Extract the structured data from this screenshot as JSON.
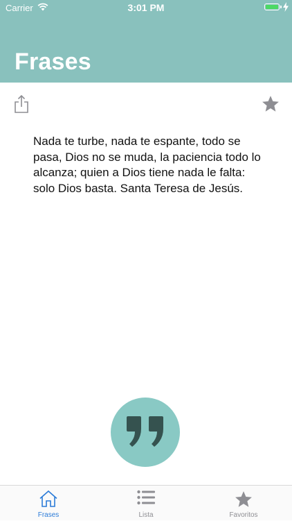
{
  "status_bar": {
    "carrier": "Carrier",
    "time": "3:01 PM",
    "wifi_icon": "wifi-icon",
    "battery_icon": "battery-icon",
    "battery_level": 1.0
  },
  "header": {
    "title": "Frases",
    "background_color": "#89c1bd"
  },
  "toolbar": {
    "share_icon": "share-icon",
    "favorite_icon": "star-icon"
  },
  "quote": {
    "text": "Nada te turbe, nada te espante, todo se pasa, Dios no se muda, la paciencia todo lo alcanza; quien a Dios tiene nada le falta: solo Dios basta. Santa Teresa de Jesús."
  },
  "new_quote_button": {
    "icon": "quote-marks-icon",
    "color": "#89c9c4"
  },
  "tab_bar": {
    "tabs": [
      {
        "label": "Frases",
        "icon": "home-icon",
        "active": true
      },
      {
        "label": "Lista",
        "icon": "list-icon",
        "active": false
      },
      {
        "label": "Favoritos",
        "icon": "star-icon",
        "active": false
      }
    ],
    "active_color": "#2b7bd8",
    "inactive_color": "#8e8e93"
  }
}
